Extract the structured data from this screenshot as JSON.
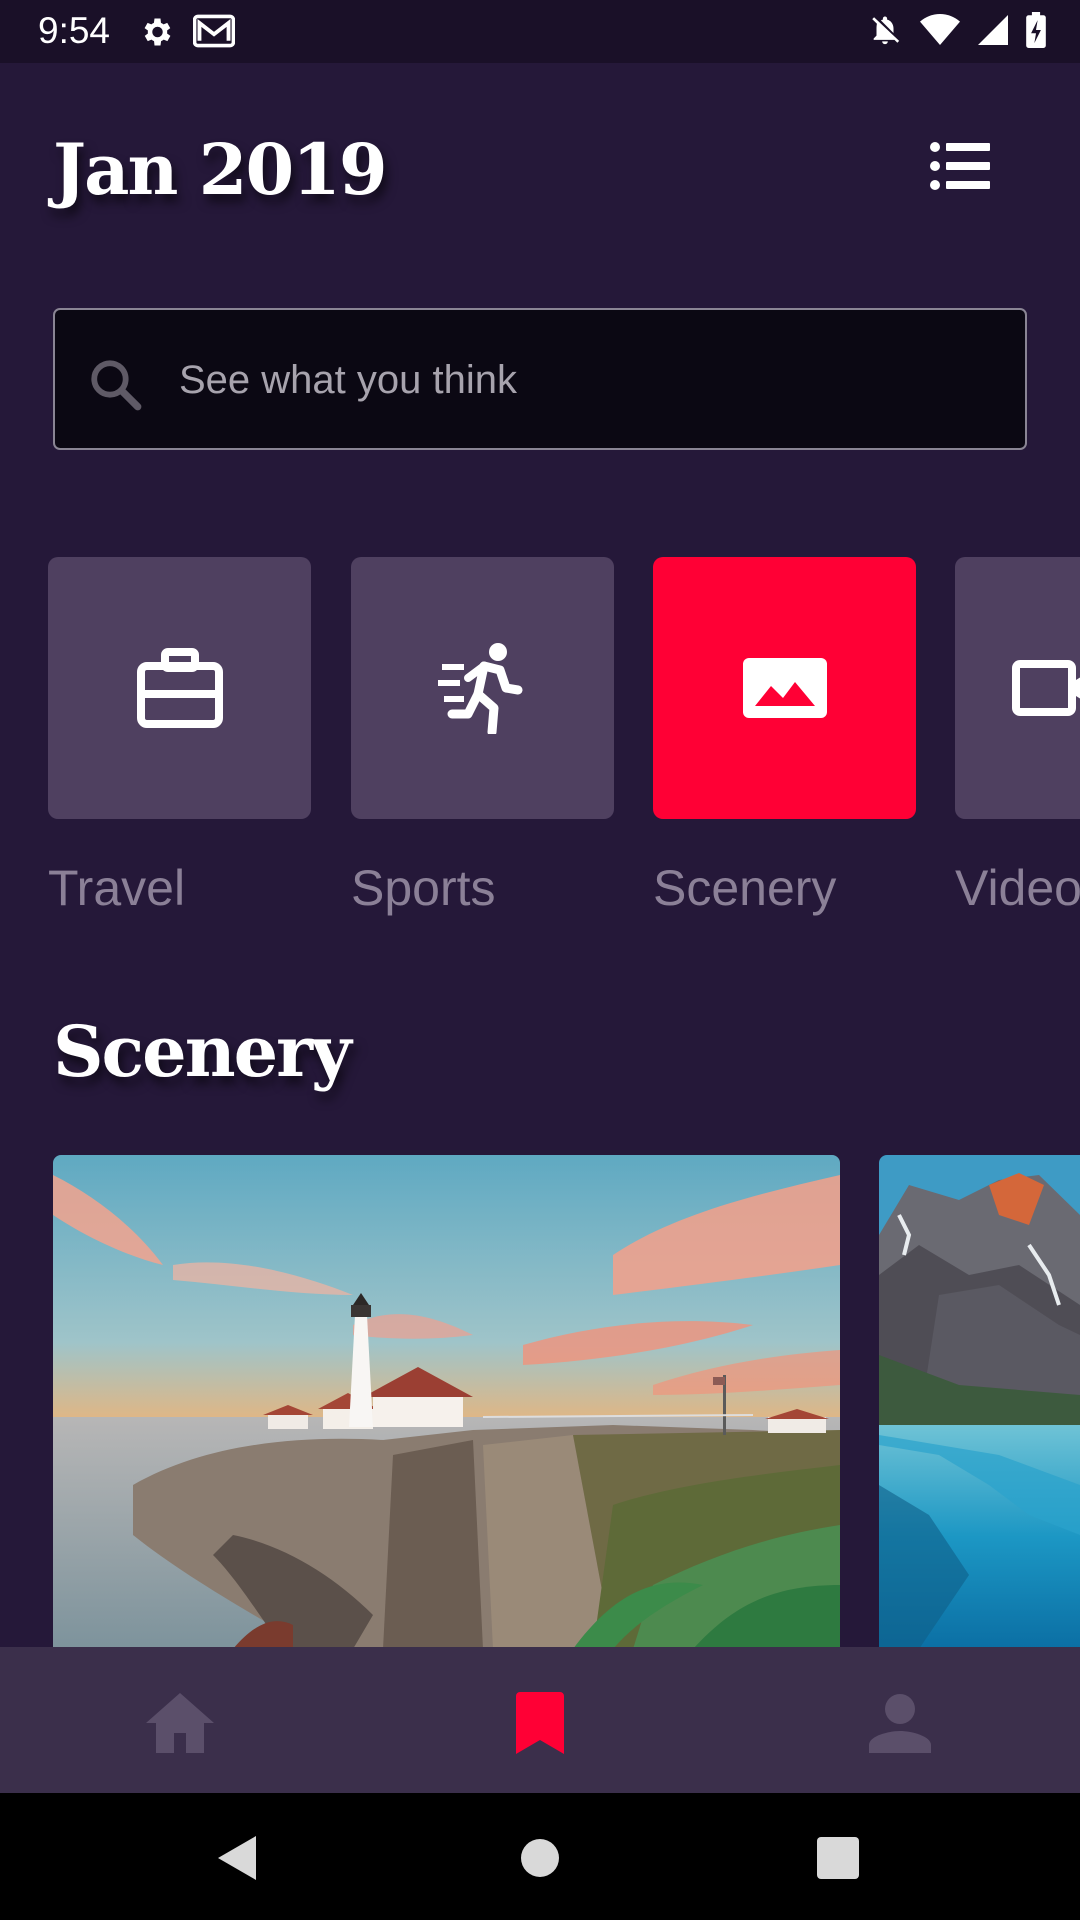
{
  "status_bar": {
    "time": "9:54",
    "left_icons": [
      "gear-icon",
      "mail-icon"
    ],
    "right_icons": [
      "notifications-off-icon",
      "wifi-icon",
      "signal-icon",
      "battery-charging-icon"
    ]
  },
  "header": {
    "title": "Jan 2019",
    "menu_icon": "list-menu-icon"
  },
  "search": {
    "placeholder": "See what you think",
    "value": "",
    "icon": "search-icon"
  },
  "categories": [
    {
      "label": "Travel",
      "icon": "briefcase-icon",
      "active": false
    },
    {
      "label": "Sports",
      "icon": "running-icon",
      "active": false
    },
    {
      "label": "Scenery",
      "icon": "image-icon",
      "active": true
    },
    {
      "label": "Video",
      "icon": "video-icon",
      "active": false
    }
  ],
  "section": {
    "title": "Scenery"
  },
  "cards": [
    {
      "subject": "lighthouse-cliff"
    },
    {
      "subject": "mountain-lake"
    }
  ],
  "bottom_nav": [
    {
      "icon": "home-icon",
      "active": false
    },
    {
      "icon": "bookmark-icon",
      "active": true
    },
    {
      "icon": "person-icon",
      "active": false
    }
  ],
  "colors": {
    "background": "#251839",
    "accent": "#ff0035",
    "tile": "#4f4060",
    "nav_bar": "#3b2f4b",
    "inactive_text": "#8b8097"
  }
}
